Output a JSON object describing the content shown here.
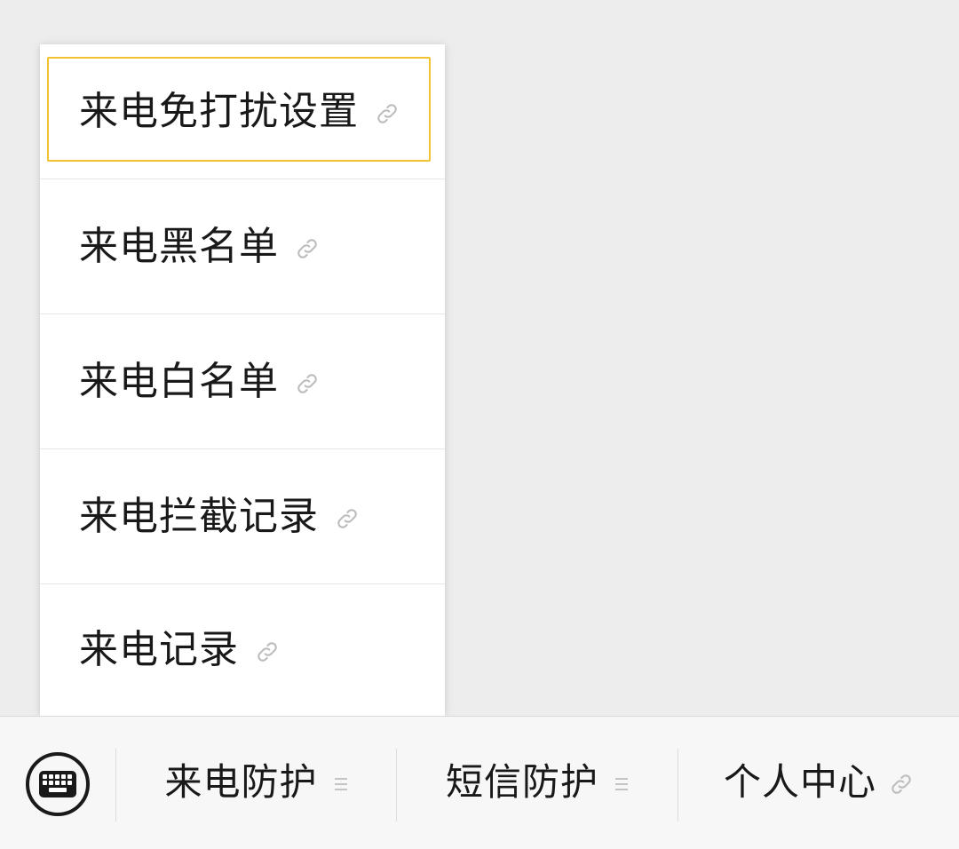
{
  "popup_menu": {
    "items": [
      {
        "label": "来电免打扰设置",
        "icon": "link-icon",
        "selected": true
      },
      {
        "label": "来电黑名单",
        "icon": "link-icon",
        "selected": false
      },
      {
        "label": "来电白名单",
        "icon": "link-icon",
        "selected": false
      },
      {
        "label": "来电拦截记录",
        "icon": "link-icon",
        "selected": false
      },
      {
        "label": "来电记录",
        "icon": "link-icon",
        "selected": false
      }
    ],
    "selection_color": "#f2c230"
  },
  "bottom_bar": {
    "keyboard_icon": "keyboard-icon",
    "tabs": [
      {
        "label": "来电防护",
        "icon": "menu-lines-icon"
      },
      {
        "label": "短信防护",
        "icon": "menu-lines-icon"
      },
      {
        "label": "个人中心",
        "icon": "link-icon"
      }
    ]
  }
}
